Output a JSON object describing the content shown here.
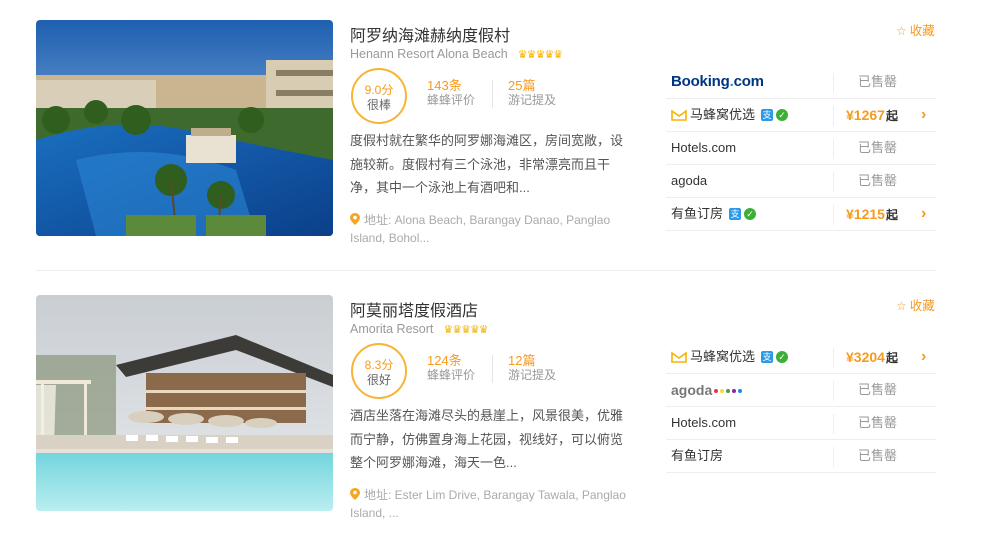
{
  "hotels": [
    {
      "name_cn": "阿罗纳海滩赫纳度假村",
      "name_en": "Henann Resort Alona Beach",
      "crowns": "♛♛♛♛♛",
      "score": "9.0分",
      "level": "很棒",
      "reviews_count": "143条",
      "reviews_label": "蜂蜂评价",
      "mentions_count": "25篇",
      "mentions_label": "游记提及",
      "description": "度假村就在繁华的阿罗娜海滩区，房间宽敞，设施较新。度假村有三个泳池，非常漂亮而且干净，其中一个泳池上有酒吧和...",
      "address": "地址: Alona Beach, Barangay Danao, Panglao Island, Bohol...",
      "fav_label": "收藏",
      "ota": [
        {
          "name": "Booking.com",
          "type": "booking",
          "status": "已售罄"
        },
        {
          "name": "马蜂窝优选",
          "type": "mafengwo",
          "price": "¥1267",
          "suffix": "起"
        },
        {
          "name": "Hotels.com",
          "type": "plain",
          "status": "已售罄"
        },
        {
          "name": "agoda",
          "type": "plain",
          "status": "已售罄"
        },
        {
          "name": "有鱼订房",
          "type": "youyu",
          "price": "¥1215",
          "suffix": "起"
        }
      ]
    },
    {
      "name_cn": "阿莫丽塔度假酒店",
      "name_en": "Amorita Resort",
      "crowns": "♛♛♛♛♛",
      "score": "8.3分",
      "level": "很好",
      "reviews_count": "124条",
      "reviews_label": "蜂蜂评价",
      "mentions_count": "12篇",
      "mentions_label": "游记提及",
      "description": "酒店坐落在海滩尽头的悬崖上，风景很美，优雅而宁静，仿佛置身海上花园，视线好，可以俯览整个阿罗娜海滩，海天一色...",
      "address": "地址: Ester Lim Drive, Barangay Tawala, Panglao Island, ...",
      "fav_label": "收藏",
      "ota": [
        {
          "name": "马蜂窝优选",
          "type": "mafengwo",
          "price": "¥3204",
          "suffix": "起"
        },
        {
          "name": "agoda",
          "type": "agoda-logo",
          "status": "已售罄"
        },
        {
          "name": "Hotels.com",
          "type": "plain",
          "status": "已售罄"
        },
        {
          "name": "有鱼订房",
          "type": "plain",
          "status": "已售罄"
        }
      ]
    }
  ],
  "colors": {
    "accent": "#f79a1e",
    "booking_blue": "#003580",
    "badge_blue": "#2d9ae8",
    "check_green": "#3cb035"
  },
  "icons": {
    "favorite": "star-outline-icon",
    "address": "location-pin-icon",
    "go": "chevron-right-icon",
    "crown": "crown-icon"
  }
}
